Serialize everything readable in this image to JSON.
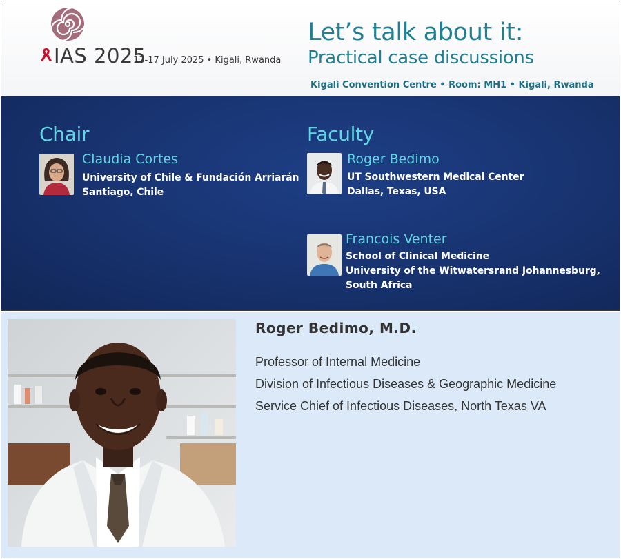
{
  "banner": {
    "org_name": "IAS 2025",
    "dates_location": "13-17 July 2025 • Kigali, Rwanda",
    "title": "Let’s talk about it:",
    "subtitle": "Practical case discussions",
    "venue": "Kigali Convention Centre • Room: MH1 • Kigali, Rwanda"
  },
  "chair": {
    "heading": "Chair",
    "name": "Claudia Cortes",
    "lines": [
      "University of Chile & Fundación Arriarán",
      "Santiago, Chile"
    ]
  },
  "faculty": {
    "heading": "Faculty",
    "members": [
      {
        "name": "Roger Bedimo",
        "lines": [
          "UT Southwestern Medical Center",
          "Dallas, Texas, USA"
        ]
      },
      {
        "name": "Francois Venter",
        "lines": [
          "School of Clinical Medicine",
          "University of the Witwatersrand Johannesburg,",
          "South Africa"
        ]
      }
    ]
  },
  "bio": {
    "name": "Roger Bedimo, M.D.",
    "lines": [
      "Professor of Internal Medicine",
      "Division of Infectious Diseases & Geographic Medicine",
      "Service Chief of Infectious Diseases, North Texas VA"
    ]
  },
  "colors": {
    "accent_teal": "#1f7f93",
    "slide_blue": "#17326e",
    "heading_cyan": "#5fd6e2",
    "ribbon_red": "#c8102e",
    "bio_bg": "#dbe9f8"
  }
}
